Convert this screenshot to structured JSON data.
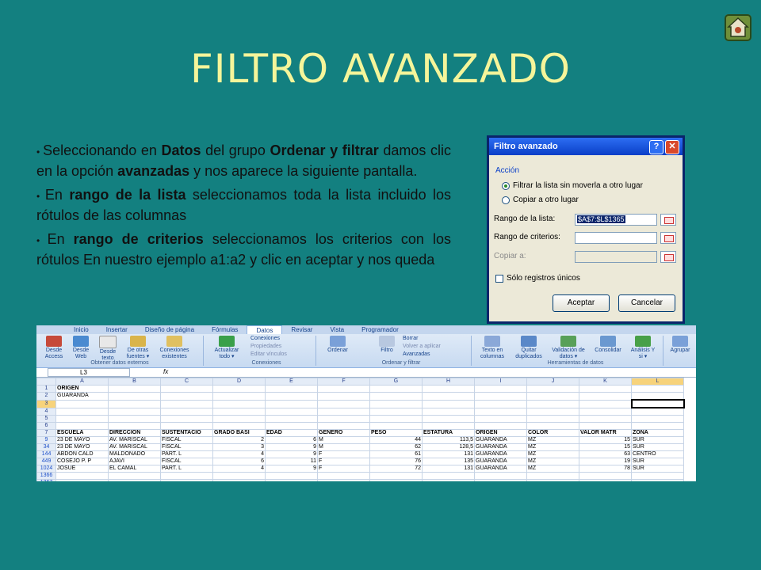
{
  "title": "FILTRO AVANZADO",
  "home_icon": "home-icon",
  "bullets": [
    {
      "segments": [
        {
          "t": "Seleccionando en ",
          "b": false
        },
        {
          "t": "Datos",
          "b": true
        },
        {
          "t": " del grupo ",
          "b": false
        },
        {
          "t": "Ordenar y filtrar",
          "b": true
        },
        {
          "t": " damos clic en la opción ",
          "b": false
        },
        {
          "t": "avanzadas",
          "b": true
        },
        {
          "t": " y nos aparece la siguiente pantalla.",
          "b": false
        }
      ]
    },
    {
      "segments": [
        {
          "t": "En ",
          "b": false
        },
        {
          "t": "rango de la lista",
          "b": true
        },
        {
          "t": " seleccionamos toda la lista incluido los rótulos de las columnas",
          "b": false
        }
      ]
    },
    {
      "segments": [
        {
          "t": "En ",
          "b": false
        },
        {
          "t": "rango de criterios",
          "b": true
        },
        {
          "t": "  seleccionamos los criterios con los rótulos En nuestro ejemplo a1:a2 y clic en aceptar y nos queda",
          "b": false
        }
      ]
    }
  ],
  "dialog": {
    "title": "Filtro avanzado",
    "help": "?",
    "close": "✕",
    "section": "Acción",
    "radio1": "Filtrar la lista sin moverla a otro lugar",
    "radio2": "Copiar a otro lugar",
    "list_range_label": "Rango de la lista:",
    "list_range_value": "$A$7:$L$1365",
    "criteria_label": "Rango de criterios:",
    "criteria_value": "",
    "copy_label": "Copiar a:",
    "copy_value": "",
    "unique_label": "Sólo registros únicos",
    "ok": "Aceptar",
    "cancel": "Cancelar"
  },
  "excel": {
    "tabs": [
      "Inicio",
      "Insertar",
      "Diseño de página",
      "Fórmulas",
      "Datos",
      "Revisar",
      "Vista",
      "Programador"
    ],
    "active_tab": "Datos",
    "ribbon": {
      "b1": "Desde Access",
      "b2": "Desde Web",
      "b3": "Desde texto",
      "b4": "De otras fuentes ▾",
      "b5": "Conexiones existentes",
      "b6": "Actualizar todo ▾",
      "c1": "Conexiones",
      "c2": "Propiedades",
      "c3": "Editar vínculos",
      "o1": "Ordenar",
      "o2": "Filtro",
      "f1": "Borrar",
      "f2": "Volver a aplicar",
      "f3": "Avanzadas",
      "t1": "Texto en columnas",
      "t2": "Quitar duplicados",
      "t3": "Validación de datos ▾",
      "t4": "Consolidar",
      "t5": "Análisis Y si ▾",
      "t6": "Agrupar",
      "g1": "Obtener datos externos",
      "g2": "Conexiones",
      "g3": "Ordenar y filtrar",
      "g4": "Herramientas de datos"
    },
    "namebox": "L3",
    "fx": "fx",
    "columns": [
      "A",
      "B",
      "C",
      "D",
      "E",
      "F",
      "G",
      "H",
      "I",
      "J",
      "K",
      "L"
    ],
    "rows": [
      {
        "n": "1",
        "cells": [
          "ORIGEN",
          "",
          "",
          "",
          "",
          "",
          "",
          "",
          "",
          "",
          "",
          ""
        ]
      },
      {
        "n": "2",
        "cells": [
          "GUARANDA",
          "",
          "",
          "",
          "",
          "",
          "",
          "",
          "",
          "",
          "",
          ""
        ]
      },
      {
        "n": "3",
        "cells": [
          "",
          "",
          "",
          "",
          "",
          "",
          "",
          "",
          "",
          "",
          "",
          ""
        ]
      },
      {
        "n": "4",
        "cells": [
          "",
          "",
          "",
          "",
          "",
          "",
          "",
          "",
          "",
          "",
          "",
          ""
        ]
      },
      {
        "n": "5",
        "cells": [
          "",
          "",
          "",
          "",
          "",
          "",
          "",
          "",
          "",
          "",
          "",
          ""
        ]
      },
      {
        "n": "6",
        "cells": [
          "",
          "",
          "",
          "",
          "",
          "",
          "",
          "",
          "",
          "",
          "",
          ""
        ]
      },
      {
        "n": "7",
        "cells": [
          "ESCUELA",
          "DIRECCIÓN",
          "SUSTENTACIO",
          "GRADO BÁSI",
          "EDAD",
          "GÉNERO",
          "PESO",
          "ESTATURA",
          "ORIGEN",
          "COLOR",
          "VALOR MATR",
          "ZONA"
        ]
      },
      {
        "n": "9",
        "cells": [
          "23 DE MAYO",
          "AV. MARISCAL",
          "FISCAL",
          "2",
          "6",
          "M",
          "44",
          "113,5",
          "GUARANDA",
          "MZ",
          "15",
          "SUR"
        ]
      },
      {
        "n": "34",
        "cells": [
          "23 DE MAYO",
          "AV. MARISCAL",
          "FISCAL",
          "3",
          "9",
          "M",
          "62",
          "128,5",
          "GUARANDA",
          "MZ",
          "15",
          "SUR"
        ]
      },
      {
        "n": "144",
        "cells": [
          "ABDON CALD",
          "MALDONADO",
          "PART. L",
          "4",
          "9",
          "F",
          "61",
          "131",
          "GUARANDA",
          "MZ",
          "63",
          "CENTRO"
        ]
      },
      {
        "n": "449",
        "cells": [
          "COSEJO P. P",
          "AJAVI",
          "FISCAL",
          "6",
          "11",
          "F",
          "76",
          "135",
          "GUARANDA",
          "MZ",
          "19",
          "SUR"
        ]
      },
      {
        "n": "1024",
        "cells": [
          "JOSUE",
          "EL CAMAL",
          "PART. L",
          "4",
          "9",
          "F",
          "72",
          "131",
          "GUARANDA",
          "MZ",
          "78",
          "SUR"
        ]
      },
      {
        "n": "1366",
        "cells": [
          "",
          "",
          "",
          "",
          "",
          "",
          "",
          "",
          "",
          "",
          "",
          ""
        ]
      },
      {
        "n": "1367",
        "cells": [
          "",
          "",
          "",
          "",
          "",
          "",
          "",
          "",
          "",
          "",
          "",
          ""
        ]
      }
    ]
  }
}
